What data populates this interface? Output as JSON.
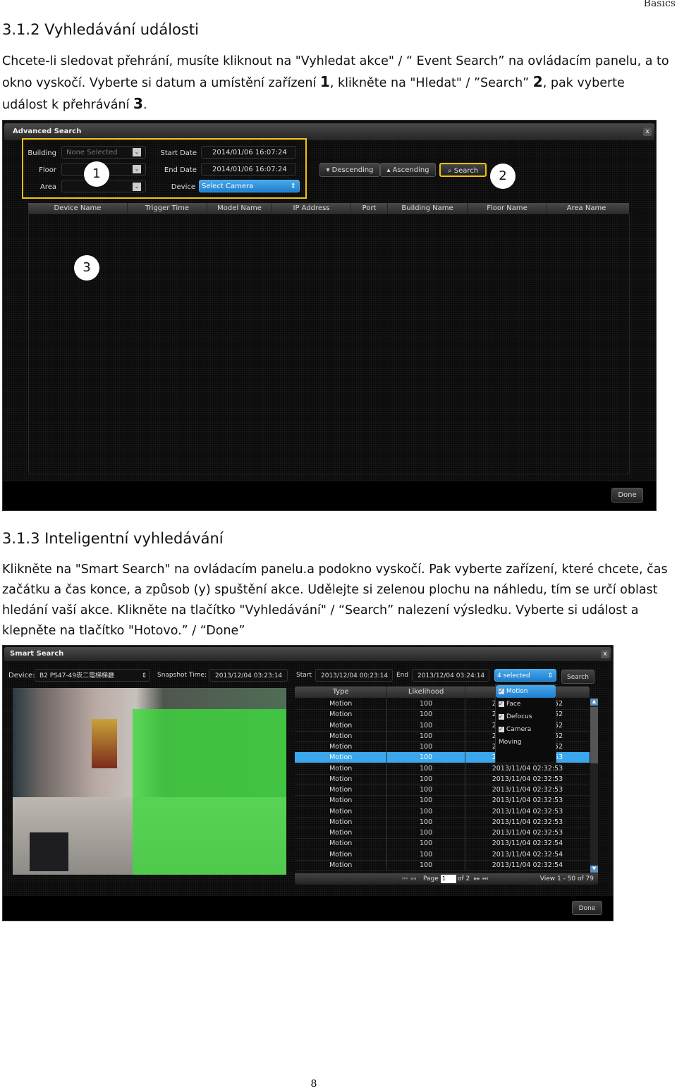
{
  "header": {
    "section": "Basics"
  },
  "sec312": {
    "title": "3.1.2 Vyhledávání události",
    "p1": "Chcete-li sledovat přehrání, musíte kliknout na \"Vyhledat akce\" / “ Event Search”   na ovládacím panelu, a to okno vyskočí. Vyberte si datum a umístění zařízení ",
    "n1": "1",
    "p2": ", klikněte na \"Hledat\" / ”Search” ",
    "n2": "2",
    "p3": ", pak vyberte událost k přehrávání ",
    "n3": "3",
    "p4": "."
  },
  "advanced": {
    "title": "Advanced Search",
    "close": "x",
    "building_label": "Building",
    "building_value": "None Selected",
    "floor_label": "Floor",
    "floor_value": "",
    "area_label": "Area",
    "area_value": "",
    "start_label": "Start Date",
    "start_value": "2014/01/06 16:07:24",
    "end_label": "End Date",
    "end_value": "2014/01/06 16:07:24",
    "device_label": "Device",
    "device_value": "Select Camera",
    "descending": "Descending",
    "ascending": "Ascending",
    "search": "Search",
    "columns": [
      "Device Name",
      "Trigger Time",
      "Model Name",
      "IP Address",
      "Port",
      "Building Name",
      "Floor Name",
      "Area Name"
    ],
    "done": "Done",
    "markers": [
      "1",
      "2",
      "3"
    ],
    "highlight_color": "#f4c20d"
  },
  "sec313": {
    "title": "3.1.3 Inteligentní vyhledávání",
    "text": "Klikněte na \"Smart Search\" na ovládacím panelu.a podokno vyskočí. Pak vyberte zařízení, které chcete, čas začátku a čas konce, a způsob (y) spuštění akce. Udělejte si zelenou plochu na náhledu, tím se určí oblast hledání vaší akce. Klikněte na tlačítko \"Vyhledávání\" / “Search” nalezení výsledku. Vyberte si událost a klepněte na tlačítko \"Hotovo.” / “Done”"
  },
  "smart": {
    "title": "Smart Search",
    "close": "x",
    "device_label": "Device:",
    "device_value": "B2 PS47-49崁二電梯梯廳",
    "snapshot_label": "Snapshot Time:",
    "snapshot_value": "2013/12/04 03:23:14",
    "start_label": "Start",
    "start_value": "2013/12/04 00:23:14",
    "end_label": "End",
    "end_value": "2013/12/04 03:24:14",
    "type_select": "4 selected",
    "search": "Search",
    "type_options": [
      {
        "label": "Motion",
        "checked": true
      },
      {
        "label": "Face",
        "checked": true
      },
      {
        "label": "Defocus",
        "checked": true
      },
      {
        "label": "Camera Moving",
        "checked": true
      }
    ],
    "columns": [
      "Type",
      "Likelihood",
      ""
    ],
    "rows": [
      {
        "type": "Motion",
        "likelihood": "100",
        "time": "2013/11/04 02:32:52"
      },
      {
        "type": "Motion",
        "likelihood": "100",
        "time": "2013/11/04 02:32:52"
      },
      {
        "type": "Motion",
        "likelihood": "100",
        "time": "2013/11/04 02:32:52"
      },
      {
        "type": "Motion",
        "likelihood": "100",
        "time": "2013/11/04 02:32:52"
      },
      {
        "type": "Motion",
        "likelihood": "100",
        "time": "2013/11/04 02:32:52"
      },
      {
        "type": "Motion",
        "likelihood": "100",
        "time": "2013/11/04 02:32:53",
        "selected": true
      },
      {
        "type": "Motion",
        "likelihood": "100",
        "time": "2013/11/04 02:32:53"
      },
      {
        "type": "Motion",
        "likelihood": "100",
        "time": "2013/11/04 02:32:53"
      },
      {
        "type": "Motion",
        "likelihood": "100",
        "time": "2013/11/04 02:32:53"
      },
      {
        "type": "Motion",
        "likelihood": "100",
        "time": "2013/11/04 02:32:53"
      },
      {
        "type": "Motion",
        "likelihood": "100",
        "time": "2013/11/04 02:32:53"
      },
      {
        "type": "Motion",
        "likelihood": "100",
        "time": "2013/11/04 02:32:53"
      },
      {
        "type": "Motion",
        "likelihood": "100",
        "time": "2013/11/04 02:32:53"
      },
      {
        "type": "Motion",
        "likelihood": "100",
        "time": "2013/11/04 02:32:54"
      },
      {
        "type": "Motion",
        "likelihood": "100",
        "time": "2013/11/04 02:32:54"
      },
      {
        "type": "Motion",
        "likelihood": "100",
        "time": "2013/11/04 02:32:54"
      }
    ],
    "pager": {
      "page_label": "Page",
      "page_value": "1",
      "of": "of 2",
      "view": "View 1 - 50 of 79"
    },
    "done": "Done",
    "selection_color": "#3aa6ec",
    "region_color": "#3ed93e"
  },
  "footer": {
    "page_number": "8"
  }
}
